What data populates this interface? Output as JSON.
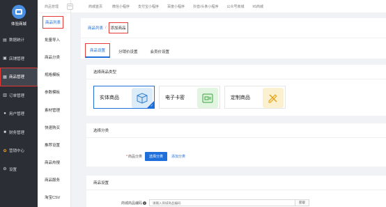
{
  "sidebar": {
    "store_name": "体验商城",
    "items": [
      {
        "label": "数据统计",
        "icon": "chart-icon"
      },
      {
        "label": "店铺管理",
        "icon": "store-icon"
      },
      {
        "label": "商品管理",
        "icon": "goods-icon"
      },
      {
        "label": "订单管理",
        "icon": "order-icon"
      },
      {
        "label": "用户管理",
        "icon": "user-icon"
      },
      {
        "label": "财务管理",
        "icon": "finance-icon"
      },
      {
        "label": "营销中心",
        "icon": "marketing-icon"
      },
      {
        "label": "设置",
        "icon": "gear-icon"
      }
    ]
  },
  "subnav": {
    "head": "商品管理",
    "items": [
      "商品列表",
      "批量导入",
      "商品分类",
      "规格模板",
      "参数模板",
      "素材管理",
      "快速购买",
      "推荐设置",
      "商品热搜",
      "商品服务",
      "淘宝CSV"
    ]
  },
  "topbar": {
    "collapse_label": "<<",
    "tabs": [
      "商城首页",
      "微信小程序",
      "支付宝小程序",
      "百度小程序",
      "抖音/头条小程序",
      "公众号商城",
      "h5商城"
    ]
  },
  "breadcrumb": {
    "link": "商品列表",
    "sep": "/",
    "current": "添加商品"
  },
  "tabs": [
    "商品设置",
    "分销价设置",
    "会员价设置"
  ],
  "type_section": {
    "title": "选择商品类型",
    "types": [
      {
        "label": "实体商品",
        "color": "#dcecf8"
      },
      {
        "label": "电子卡密",
        "color": "#e2f5e0"
      },
      {
        "label": "定制商品",
        "color": "#fbf0cf"
      }
    ]
  },
  "category_section": {
    "title": "选择分类",
    "label": "商品分类",
    "select_btn": "选择分类",
    "add_link": "添加分类"
  },
  "settings_section": {
    "title": "商品设置",
    "code_label": "商城商品编码",
    "code_placeholder": "请输入商城商品编码",
    "code_btn": "获取"
  }
}
